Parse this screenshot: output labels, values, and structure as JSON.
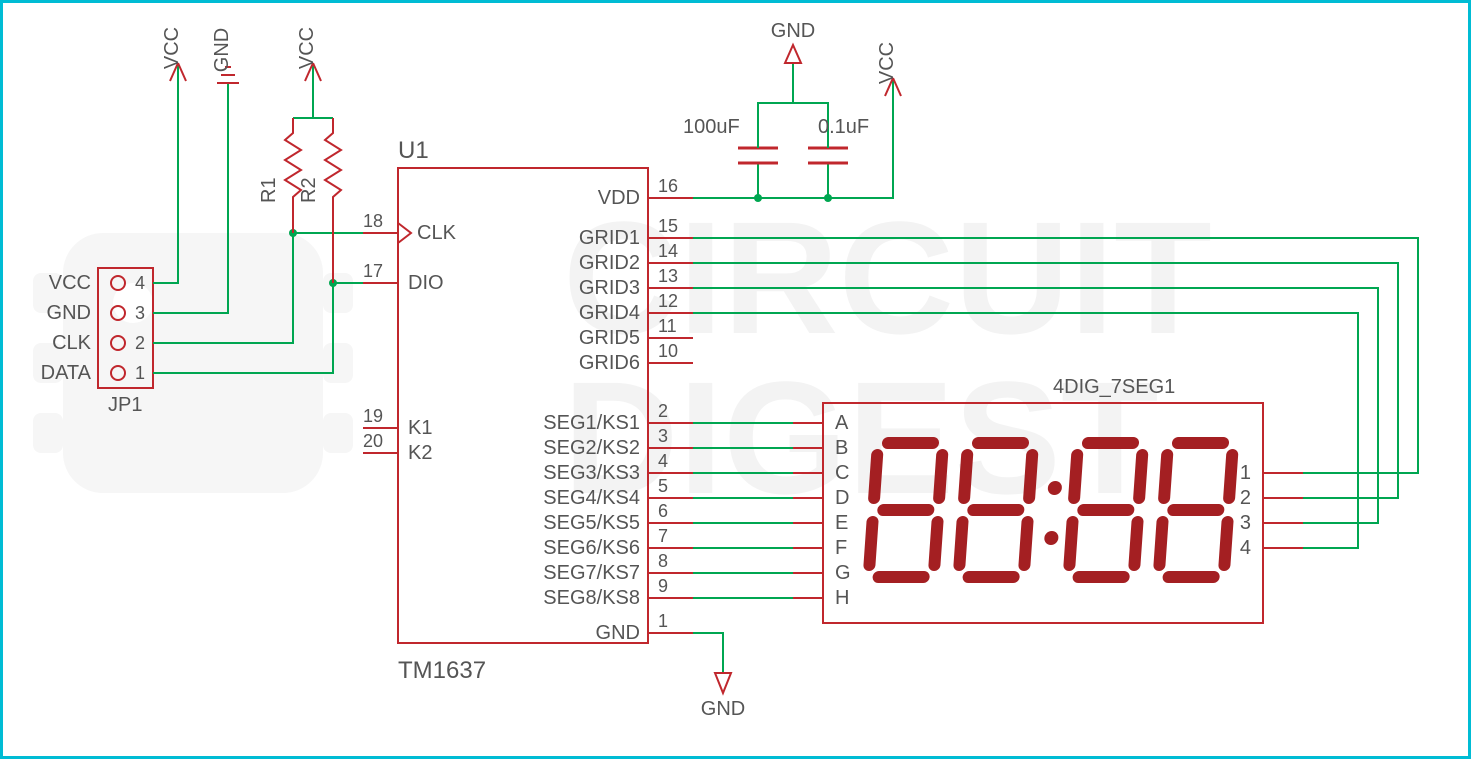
{
  "connector": {
    "name": "JP1",
    "pins": [
      {
        "num": "4",
        "label": "VCC"
      },
      {
        "num": "3",
        "label": "GND"
      },
      {
        "num": "2",
        "label": "CLK"
      },
      {
        "num": "1",
        "label": "DATA"
      }
    ]
  },
  "pullups": {
    "r1": "R1",
    "r2": "R2"
  },
  "nets": {
    "vcc": "VCC",
    "gnd": "GND"
  },
  "caps": {
    "c1": "100uF",
    "c2": "0.1uF"
  },
  "ic": {
    "ref": "U1",
    "part": "TM1637",
    "left": [
      {
        "num": "18",
        "label": "CLK",
        "has_triangle": true
      },
      {
        "num": "17",
        "label": "DIO"
      },
      {
        "num": "19",
        "label": "K1"
      },
      {
        "num": "20",
        "label": "K2"
      }
    ],
    "right_top": [
      {
        "num": "16",
        "label": "VDD"
      }
    ],
    "grids": [
      {
        "num": "15",
        "label": "GRID1"
      },
      {
        "num": "14",
        "label": "GRID2"
      },
      {
        "num": "13",
        "label": "GRID3"
      },
      {
        "num": "12",
        "label": "GRID4"
      },
      {
        "num": "11",
        "label": "GRID5"
      },
      {
        "num": "10",
        "label": "GRID6"
      }
    ],
    "segs": [
      {
        "num": "2",
        "label": "SEG1/KS1"
      },
      {
        "num": "3",
        "label": "SEG2/KS2"
      },
      {
        "num": "4",
        "label": "SEG3/KS3"
      },
      {
        "num": "5",
        "label": "SEG4/KS4"
      },
      {
        "num": "6",
        "label": "SEG5/KS5"
      },
      {
        "num": "7",
        "label": "SEG6/KS6"
      },
      {
        "num": "8",
        "label": "SEG7/KS7"
      },
      {
        "num": "9",
        "label": "SEG8/KS8"
      }
    ],
    "gnd": {
      "num": "1",
      "label": "GND"
    }
  },
  "display": {
    "ref": "4DIG_7SEG1",
    "left": [
      "A",
      "B",
      "C",
      "D",
      "E",
      "F",
      "G",
      "H"
    ],
    "right": [
      "1",
      "2",
      "3",
      "4"
    ]
  }
}
